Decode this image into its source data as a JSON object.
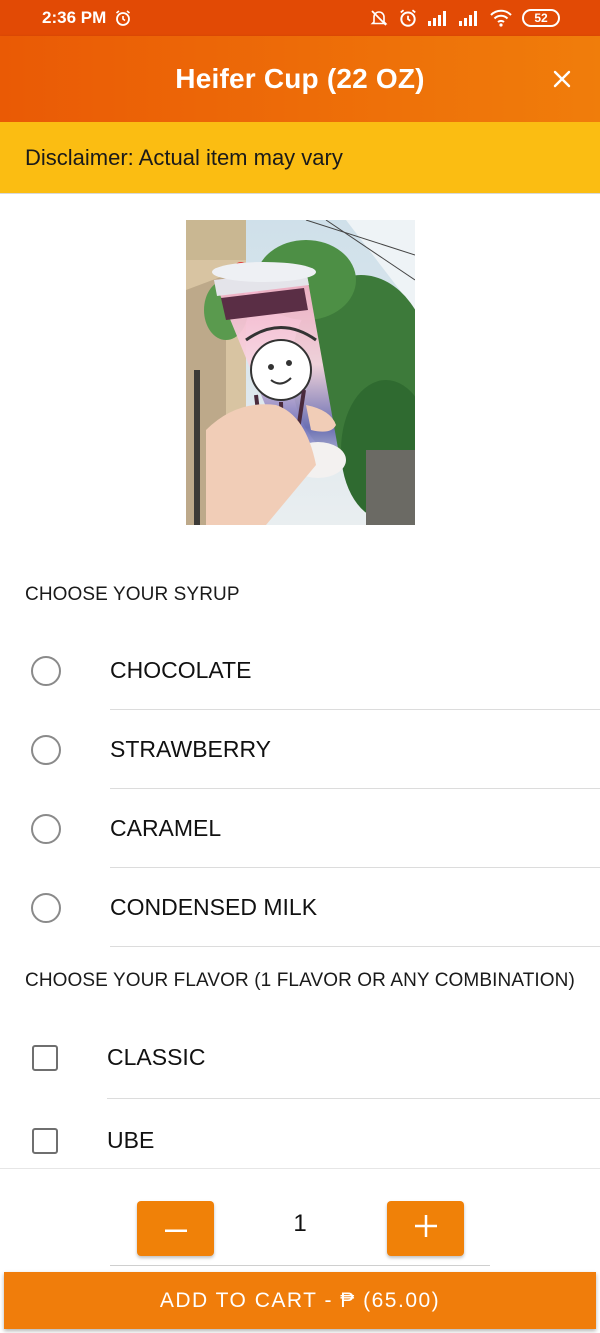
{
  "status_bar": {
    "time": "2:36 PM",
    "battery": "52",
    "icons": [
      "alarm-icon",
      "mute-icon",
      "alarm-icon",
      "signal-icon",
      "signal-icon",
      "wifi-icon",
      "battery-icon"
    ]
  },
  "header": {
    "title": "Heifer Cup (22 OZ)",
    "close_icon": "close-icon"
  },
  "disclaimer": "Disclaimer: Actual item may vary",
  "syrup_section": {
    "label": "CHOOSE YOUR SYRUP",
    "options": [
      {
        "label": "CHOCOLATE",
        "selected": false
      },
      {
        "label": "STRAWBERRY",
        "selected": false
      },
      {
        "label": "CARAMEL",
        "selected": false
      },
      {
        "label": "CONDENSED MILK",
        "selected": false
      }
    ]
  },
  "flavor_section": {
    "label": "CHOOSE YOUR FLAVOR (1 FLAVOR OR ANY COMBINATION)",
    "options": [
      {
        "label": "CLASSIC",
        "checked": false
      },
      {
        "label": "UBE",
        "checked": false
      }
    ]
  },
  "quantity": {
    "value": "1",
    "decrement_icon": "minus-icon",
    "increment_icon": "plus-icon"
  },
  "add_to_cart": {
    "label": "ADD TO CART - ₱ (65.00)"
  },
  "colors": {
    "status_bar": "#e24a05",
    "header_start": "#ea5a05",
    "header_end": "#f07d0b",
    "disclaimer_bg": "#fbbd12",
    "accent": "#f08108"
  }
}
